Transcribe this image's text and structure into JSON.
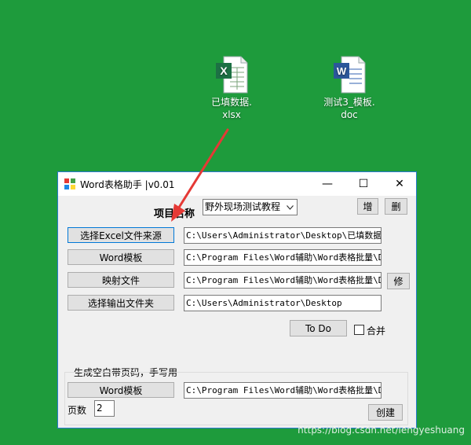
{
  "desktop": {
    "icons": [
      {
        "label_line1": "已填数据.",
        "label_line2": "xlsx"
      },
      {
        "label_line1": "测试3_模板.",
        "label_line2": "doc"
      }
    ]
  },
  "window": {
    "title": "Word表格助手 |v0.01",
    "controls": {
      "minimize": "—",
      "maximize": "☐",
      "close": "✕"
    }
  },
  "project": {
    "label": "项目名称",
    "selected": "野外现场测试教程",
    "add_label": "增",
    "delete_label": "删"
  },
  "rows": {
    "excel_button": "选择Excel文件来源",
    "excel_path": "C:\\Users\\Administrator\\Desktop\\已填数据.xlsx",
    "template_button": "Word模板",
    "template_path": "C:\\Program Files\\Word辅助\\Word表格批量\\Data",
    "mapping_button": "映射文件",
    "mapping_path": "C:\\Program Files\\Word辅助\\Word表格批量\\Data",
    "modify_label": "修",
    "output_button": "选择输出文件夹",
    "output_path": "C:\\Users\\Administrator\\Desktop"
  },
  "actions": {
    "todo_label": "To Do",
    "merge_label": "合并"
  },
  "blank_section": {
    "title": "生成空白带页码，手写用",
    "template_button": "Word模板",
    "template_path": "C:\\Program Files\\Word辅助\\Word表格批量\\Data",
    "pages_label": "页数",
    "pages_value": "2",
    "create_label": "创建"
  },
  "watermark": "https://blog.csdn.net/lengyeshuang",
  "colors": {
    "desktop": "#1e9b3c",
    "arrow": "#e53935",
    "window_border": "#2b79d1"
  }
}
